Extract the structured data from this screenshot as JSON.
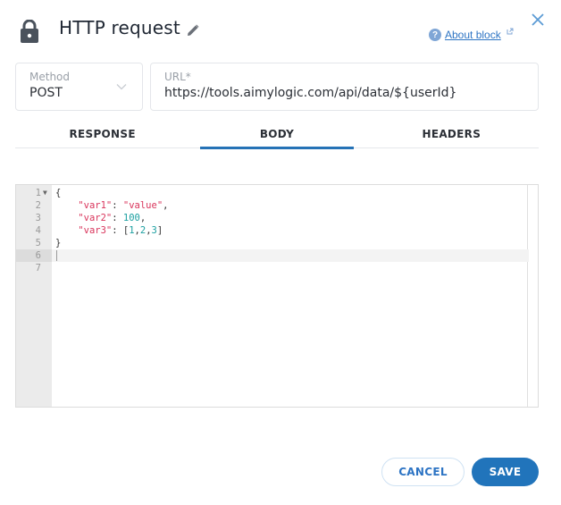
{
  "header": {
    "title": "HTTP request",
    "about_label": "About block",
    "icons": {
      "lock": "lock-icon",
      "edit": "pencil-icon",
      "help": "help-icon",
      "external": "external-link-icon",
      "close": "close-icon"
    }
  },
  "form": {
    "method": {
      "label": "Method",
      "value": "POST"
    },
    "url": {
      "label": "URL*",
      "value": "https://tools.aimylogic.com/api/data/${userId}"
    }
  },
  "tabs": [
    {
      "label": "RESPONSE",
      "active": false
    },
    {
      "label": "BODY",
      "active": true
    },
    {
      "label": "HEADERS",
      "active": false
    }
  ],
  "editor": {
    "lines": [
      {
        "n": "1",
        "text": "{"
      },
      {
        "n": "2",
        "key": "\"var1\"",
        "sep": ": ",
        "val": "\"value\"",
        "tail": ","
      },
      {
        "n": "3",
        "key": "\"var2\"",
        "sep": ": ",
        "val": "100",
        "tail": ","
      },
      {
        "n": "4",
        "key": "\"var3\"",
        "sep": ": [",
        "arr": [
          "1",
          "2",
          "3"
        ],
        "tail": "]"
      },
      {
        "n": "5",
        "text": "}"
      },
      {
        "n": "6",
        "text": ""
      },
      {
        "n": "7",
        "text": ""
      }
    ],
    "active_line": 6
  },
  "footer": {
    "cancel_label": "CANCEL",
    "save_label": "SAVE"
  },
  "colors": {
    "accent": "#2174bb",
    "link": "#2d74c4",
    "json_key": "#d9345b",
    "json_number": "#1a9fa0"
  }
}
